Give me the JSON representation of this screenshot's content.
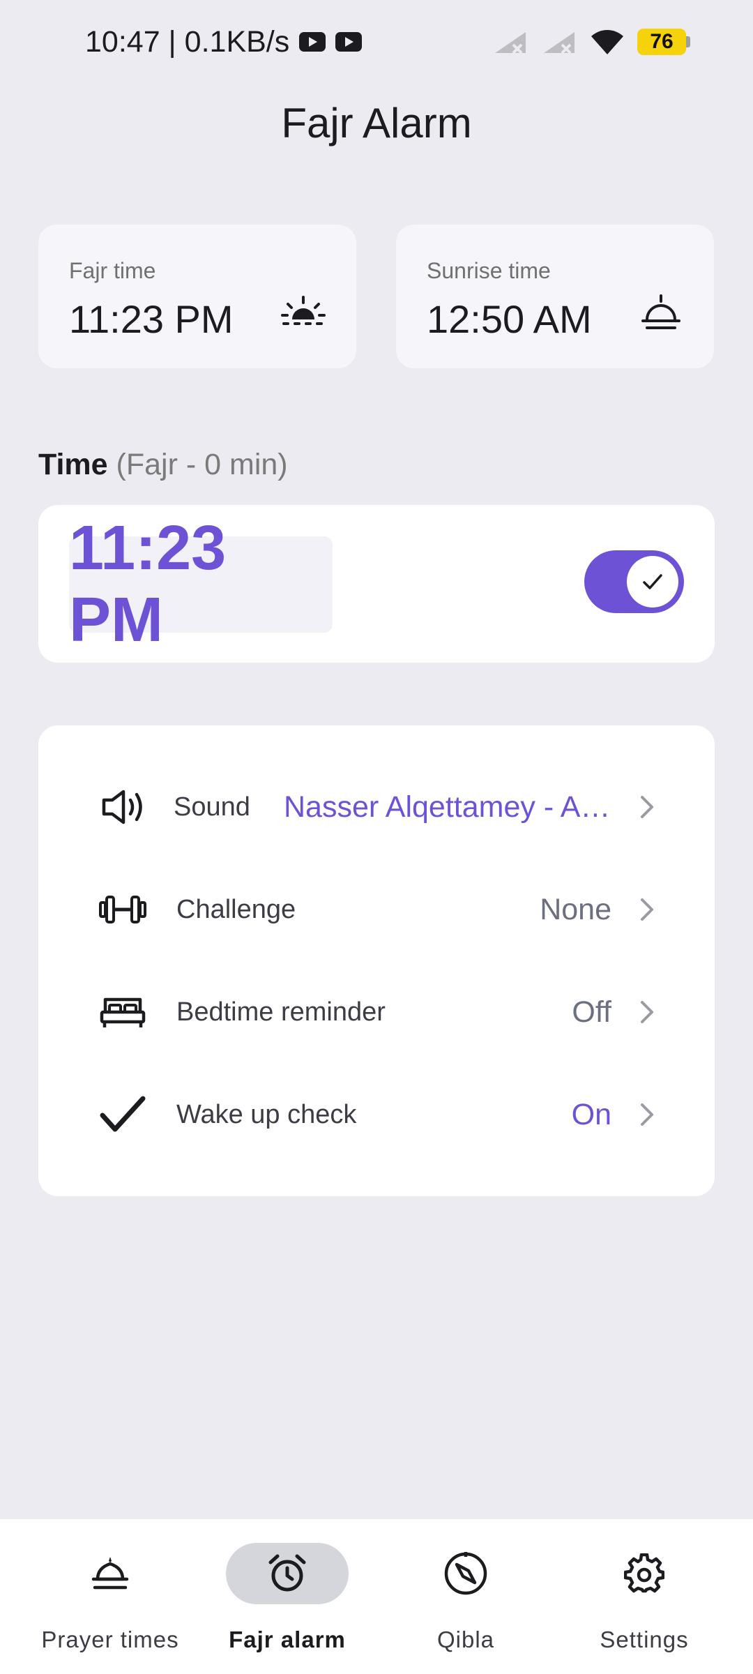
{
  "status_bar": {
    "time_speed": "10:47 | 0.1KB/s",
    "battery": "76"
  },
  "title": "Fajr Alarm",
  "prayer_cards": {
    "fajr": {
      "label": "Fajr time",
      "value": "11:23 PM",
      "icon": "sunrise-icon"
    },
    "sunrise": {
      "label": "Sunrise time",
      "value": "12:50 AM",
      "icon": "sunrise-horizon-icon"
    }
  },
  "time_section": {
    "label": "Time",
    "offset": "(Fajr - 0 min)",
    "alarm_time": "11:23 PM",
    "enabled": true
  },
  "settings": [
    {
      "label": "Sound",
      "value": "Nasser Alqettamey - Azan",
      "icon": "speaker-icon",
      "accent": true
    },
    {
      "label": "Challenge",
      "value": "None",
      "icon": "dumbbell-icon",
      "accent": false
    },
    {
      "label": "Bedtime reminder",
      "value": "Off",
      "icon": "bed-icon",
      "accent": false
    },
    {
      "label": "Wake up check",
      "value": "On",
      "icon": "checkmark-icon",
      "accent": true
    }
  ],
  "nav": [
    {
      "label": "Prayer times",
      "icon": "mosque-icon",
      "active": false
    },
    {
      "label": "Fajr alarm",
      "icon": "alarm-clock-icon",
      "active": true
    },
    {
      "label": "Qibla",
      "icon": "compass-icon",
      "active": false
    },
    {
      "label": "Settings",
      "icon": "gear-icon",
      "active": false
    }
  ],
  "colors": {
    "accent": "#6E52D5",
    "background": "#ECEBF1",
    "card": "#FFFFFF"
  }
}
